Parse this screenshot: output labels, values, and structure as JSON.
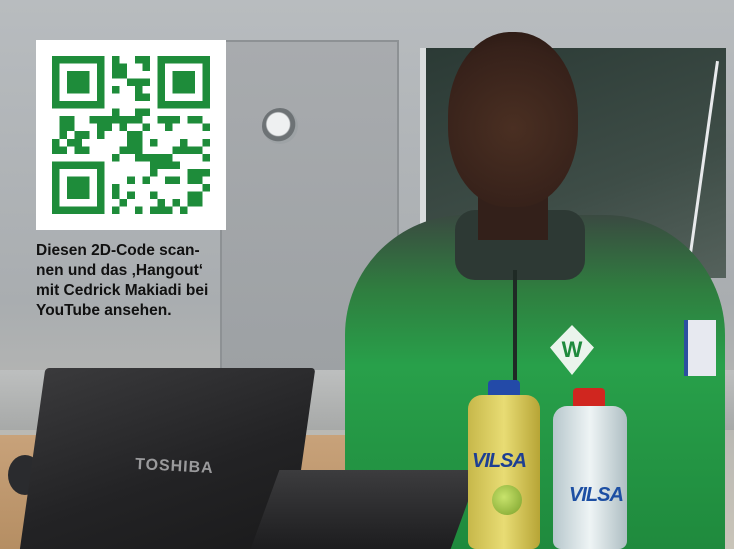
{
  "caption": {
    "lines": [
      "Diesen 2D-Code scan-",
      "nen und das ‚Hangout‘",
      "mit Cedrick Makiadi bei",
      "YouTube ansehen."
    ]
  },
  "laptop": {
    "brand": "TOSHIBA"
  },
  "bottles": {
    "left_label": "VILSA",
    "right_label": "VILSA"
  },
  "qr": {
    "color": "#1e8c3a"
  }
}
